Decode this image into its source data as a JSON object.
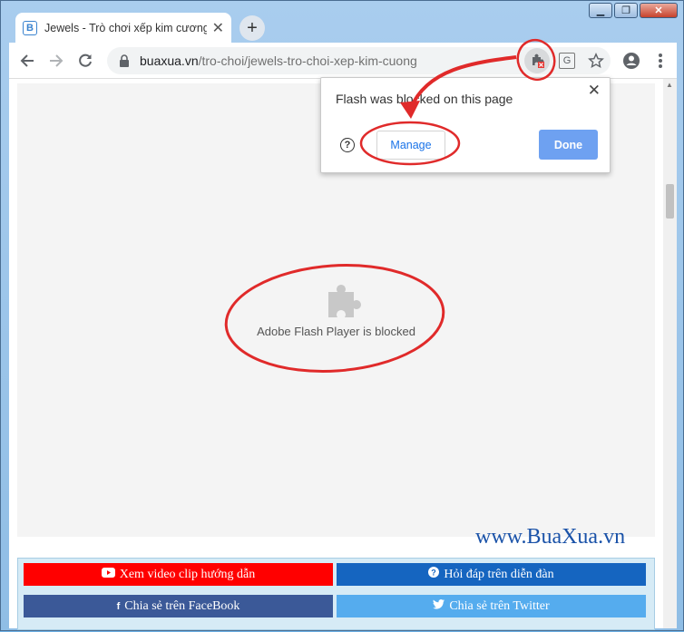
{
  "browser": {
    "tab": {
      "favicon": "B",
      "title": "Jewels - Trò chơi xếp kim cương",
      "close": "✕"
    },
    "new_tab": "+",
    "window_controls": {
      "minimize": "▁",
      "maximize": "❐",
      "close": "✕"
    },
    "url": {
      "host": "buaxua.vn",
      "path": "/tro-choi/jewels-tro-choi-xep-kim-cuong"
    },
    "icons": [
      "back-arrow-icon",
      "forward-arrow-icon",
      "reload-icon",
      "lock-icon",
      "plugin-blocked-icon",
      "translate-icon",
      "star-icon",
      "account-icon",
      "more-menu-icon"
    ]
  },
  "popup": {
    "message": "Flash was blocked on this page",
    "close": "✕",
    "help": "?",
    "manage_label": "Manage",
    "done_label": "Done"
  },
  "content": {
    "flash_message": "Adobe Flash Player is blocked",
    "watermark": "www.BuaXua.vn",
    "share_buttons": [
      {
        "label": "Xem video clip hướng dẫn",
        "icon": "youtube-icon",
        "color": "#ff0000"
      },
      {
        "label": "Hỏi đáp trên diễn đàn",
        "icon": "question-circle-icon",
        "color": "#1565c0"
      },
      {
        "label": "Chia sẻ trên FaceBook",
        "icon": "facebook-icon",
        "color": "#3b5998"
      },
      {
        "label": "Chia sẻ trên Twitter",
        "icon": "twitter-icon",
        "color": "#55acee"
      }
    ]
  },
  "colors": {
    "annotation": "#e02a2a",
    "accent": "#1a73e8",
    "done": "#6ea1f1"
  }
}
